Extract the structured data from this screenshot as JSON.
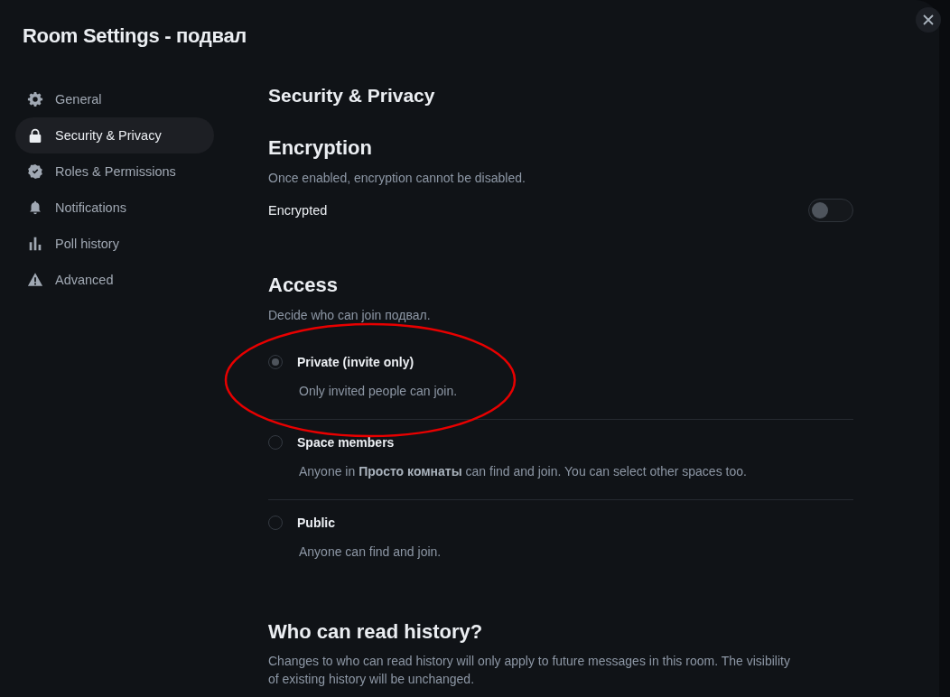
{
  "window": {
    "title": "Room Settings - подвал"
  },
  "sidebar": {
    "items": [
      {
        "label": "General",
        "selected": false
      },
      {
        "label": "Security & Privacy",
        "selected": true
      },
      {
        "label": "Roles & Permissions",
        "selected": false
      },
      {
        "label": "Notifications",
        "selected": false
      },
      {
        "label": "Poll history",
        "selected": false
      },
      {
        "label": "Advanced",
        "selected": false
      }
    ]
  },
  "page_title": "Security & Privacy",
  "encryption": {
    "heading": "Encryption",
    "description": "Once enabled, encryption cannot be disabled.",
    "toggle": {
      "label": "Encrypted",
      "on": false
    }
  },
  "access": {
    "heading": "Access",
    "description": "Decide who can join подвал.",
    "options": [
      {
        "label": "Private (invite only)",
        "description": "Only invited people can join.",
        "selected": true
      },
      {
        "label": "Space members",
        "description": "Anyone in **Просто комнаты** can find and join. You can select other spaces too.",
        "selected": false
      },
      {
        "label": "Public",
        "description": "Anyone can find and join.",
        "selected": false
      }
    ]
  },
  "history": {
    "heading": "Who can read history?",
    "description": "Changes to who can read history will only apply to future messages in this room. The visibility of existing history will be unchanged."
  }
}
